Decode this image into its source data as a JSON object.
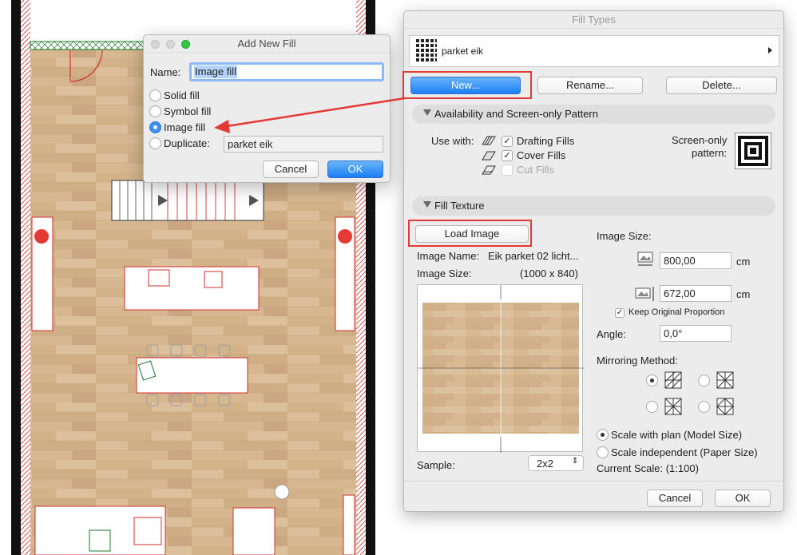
{
  "add_fill_dialog": {
    "title": "Add New Fill",
    "name_label": "Name:",
    "name_value": "Image fill",
    "options": [
      "Solid fill",
      "Symbol fill",
      "Image fill",
      "Duplicate:"
    ],
    "selected_option": "Image fill",
    "duplicate_value": "parket eik",
    "cancel_label": "Cancel",
    "ok_label": "OK"
  },
  "fill_types": {
    "title": "Fill Types",
    "current_fill": "parket eik",
    "new_label": "New...",
    "rename_label": "Rename...",
    "delete_label": "Delete...",
    "availability": {
      "title": "Availability and Screen-only Pattern",
      "use_with_label": "Use with:",
      "drafting_fills": "Drafting Fills",
      "cover_fills": "Cover Fills",
      "cut_fills": "Cut Fills",
      "drafting_checked": true,
      "cover_checked": true,
      "cut_checked": false,
      "screen_only_label_1": "Screen-only",
      "screen_only_label_2": "pattern:"
    },
    "texture": {
      "title": "Fill Texture",
      "load_image_label": "Load Image",
      "image_name_label": "Image Name:",
      "image_name_value": "Eik parket 02 licht...",
      "image_size_label": "Image Size:",
      "image_size_value": "(1000 x 840)",
      "sample_label": "Sample:",
      "sample_value": "2x2",
      "size_section_label": "Image Size:",
      "width_value": "800,00",
      "height_value": "672,00",
      "unit": "cm",
      "keep_proportion_label": "Keep Original Proportion",
      "keep_proportion_checked": true,
      "angle_label": "Angle:",
      "angle_value": "0,0°",
      "mirroring_label": "Mirroring Method:",
      "scale_with_plan_label": "Scale with plan (Model Size)",
      "scale_independent_label": "Scale independent (Paper Size)",
      "current_scale_label": "Current Scale: (1:100)"
    },
    "cancel_label": "Cancel",
    "ok_label": "OK"
  },
  "colors": {
    "accent_blue": "#1b7ff5",
    "annotation_red": "#e53935",
    "wood": "#d6b690"
  }
}
